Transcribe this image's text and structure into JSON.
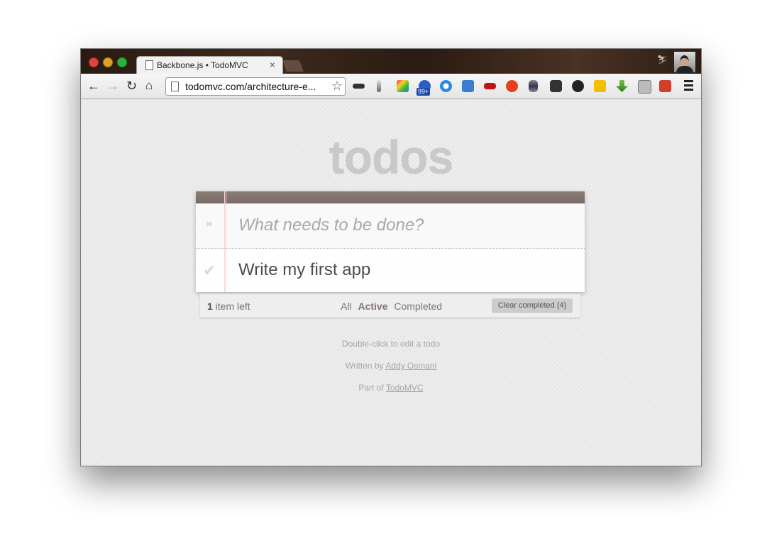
{
  "browser": {
    "tab_title": "Backbone.js • TodoMVC",
    "tab_close": "×",
    "url": "todomvc.com/architecture-e...",
    "ext_badge": "99+",
    "extensions": [
      "mask-icon",
      "tower-icon",
      "colorful-app-icon",
      "bell-icon",
      "gear-icon",
      "screen-icon",
      "sofa-icon",
      "red-circle-icon",
      "database-icon",
      "pocket-icon",
      "github-icon",
      "bolt-icon",
      "download-arrow-icon",
      "lr-icon",
      "google-plus-icon"
    ]
  },
  "app": {
    "heading": "todos",
    "placeholder": "What needs to be done?",
    "todos": [
      {
        "title": "Write my first app",
        "completed": false
      }
    ],
    "count": "1",
    "count_suffix": " item left",
    "filters": {
      "all": "All",
      "active": "Active",
      "completed": "Completed"
    },
    "selected_filter": "Active",
    "clear_label": "Clear completed (4)"
  },
  "info": {
    "edit_hint": "Double-click to edit a todo",
    "written_by": "Written by ",
    "author": "Addy Osmani",
    "part_of": "Part of ",
    "project": "TodoMVC"
  }
}
